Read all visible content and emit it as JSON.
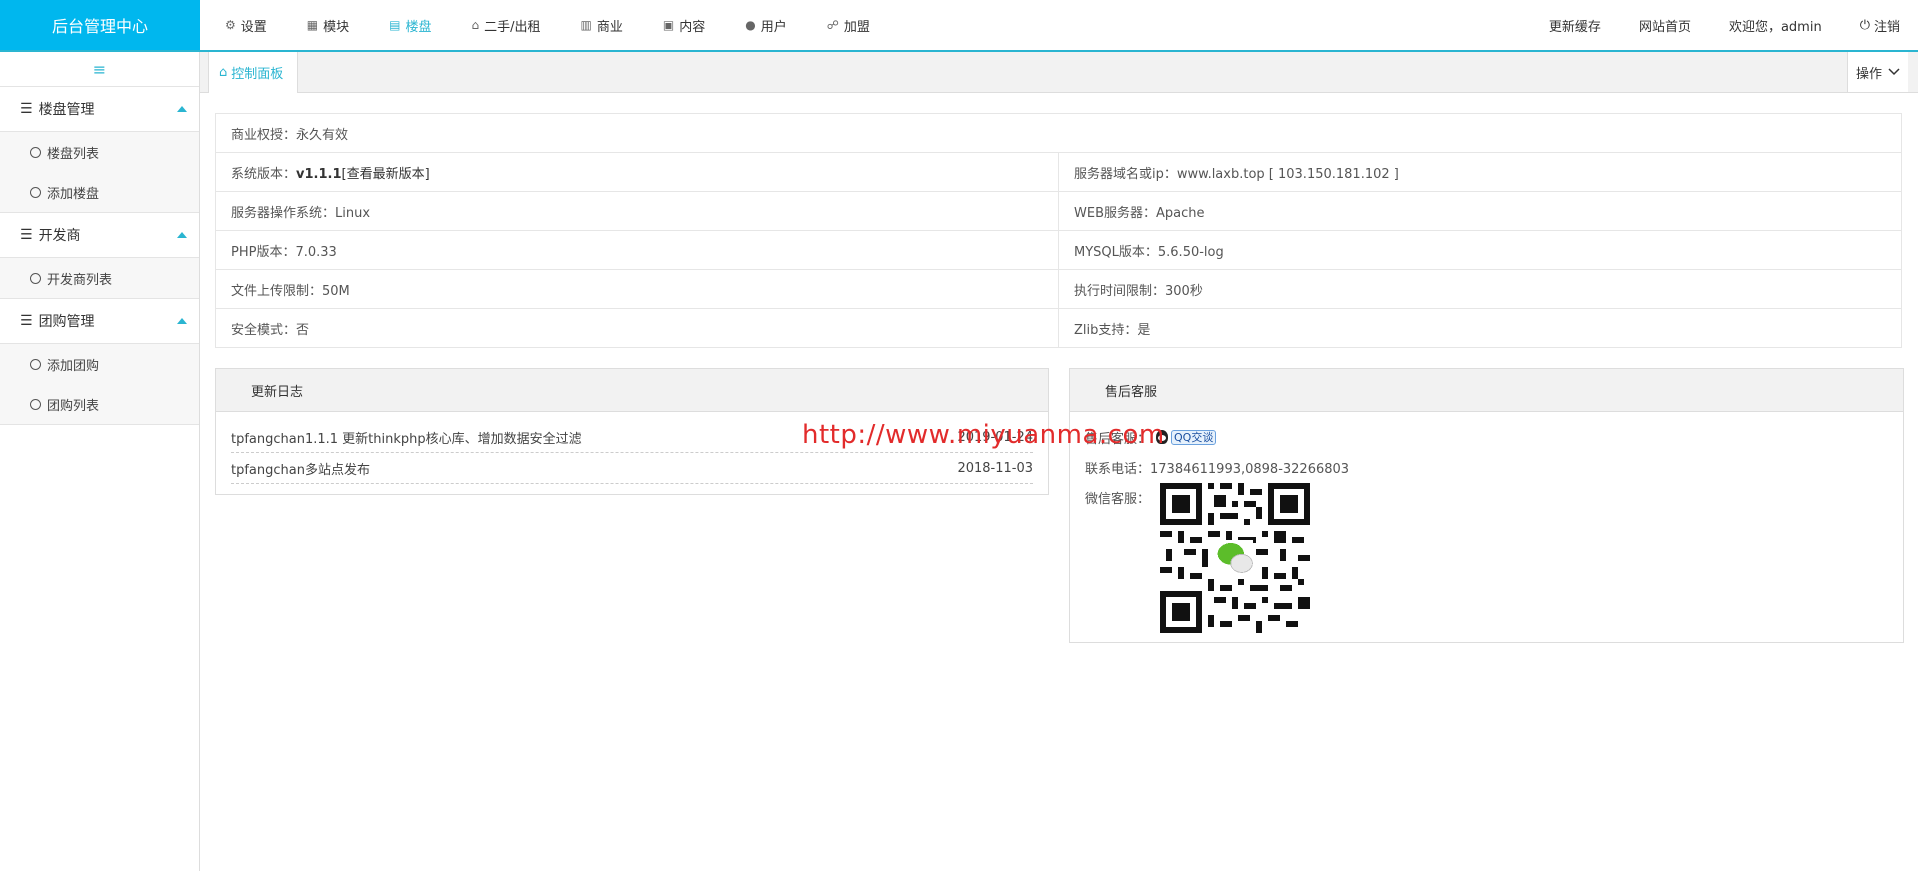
{
  "brand": "后台管理中心",
  "topnav": [
    {
      "label": "设置",
      "icon": "gear-icon",
      "glyph": "⚙",
      "active": false
    },
    {
      "label": "模块",
      "icon": "grid-icon",
      "glyph": "▦",
      "active": false
    },
    {
      "label": "楼盘",
      "icon": "building-icon",
      "glyph": "▤",
      "active": true
    },
    {
      "label": "二手/出租",
      "icon": "house-icon",
      "glyph": "⌂",
      "active": false
    },
    {
      "label": "商业",
      "icon": "bank-icon",
      "glyph": "▥",
      "active": false
    },
    {
      "label": "内容",
      "icon": "document-icon",
      "glyph": "▣",
      "active": false
    },
    {
      "label": "用户",
      "icon": "user-icon",
      "glyph": "●",
      "active": false
    },
    {
      "label": "加盟",
      "icon": "handshake-icon",
      "glyph": "☍",
      "active": false
    }
  ],
  "topright": {
    "refresh_cache": "更新缓存",
    "site_home": "网站首页",
    "welcome": "欢迎您，admin",
    "logout": "注销"
  },
  "sidebar": {
    "toggle_glyph": "≡",
    "groups": [
      {
        "title": "楼盘管理",
        "items": [
          "楼盘列表",
          "添加楼盘"
        ]
      },
      {
        "title": "开发商",
        "items": [
          "开发商列表"
        ]
      },
      {
        "title": "团购管理",
        "items": [
          "添加团购",
          "团购列表"
        ]
      }
    ]
  },
  "tabs": {
    "active_label": "控制面板",
    "ops_label": "操作"
  },
  "info": {
    "license": "商业权授：永久有效",
    "version_prefix": "系统版本：",
    "version": "v1.1.1",
    "version_link": "[查看最新版本]",
    "server_domain": "服务器域名或ip：www.laxb.top [ 103.150.181.102 ]",
    "os": "服务器操作系统：Linux",
    "web_server": "WEB服务器：Apache",
    "php": "PHP版本：7.0.33",
    "mysql": "MYSQL版本：5.6.50-log",
    "upload": "文件上传限制：50M",
    "exec_time": "执行时间限制：300秒",
    "safe_mode": "安全模式：否",
    "zlib": "Zlib支持：是"
  },
  "changelog": {
    "title": "更新日志",
    "rows": [
      {
        "text": "tpfangchan1.1.1 更新thinkphp核心库、增加数据安全过滤",
        "date": "2019-01-24"
      },
      {
        "text": "tpfangchan多站点发布",
        "date": "2018-11-03"
      }
    ]
  },
  "support": {
    "title": "售后客服",
    "qq_label": "售后客服：",
    "qq_button": "QQ交谈",
    "phone": "联系电话：17384611993,0898-32266803",
    "wechat_label": "微信客服："
  },
  "watermark": "http://www.miyuanma.com"
}
